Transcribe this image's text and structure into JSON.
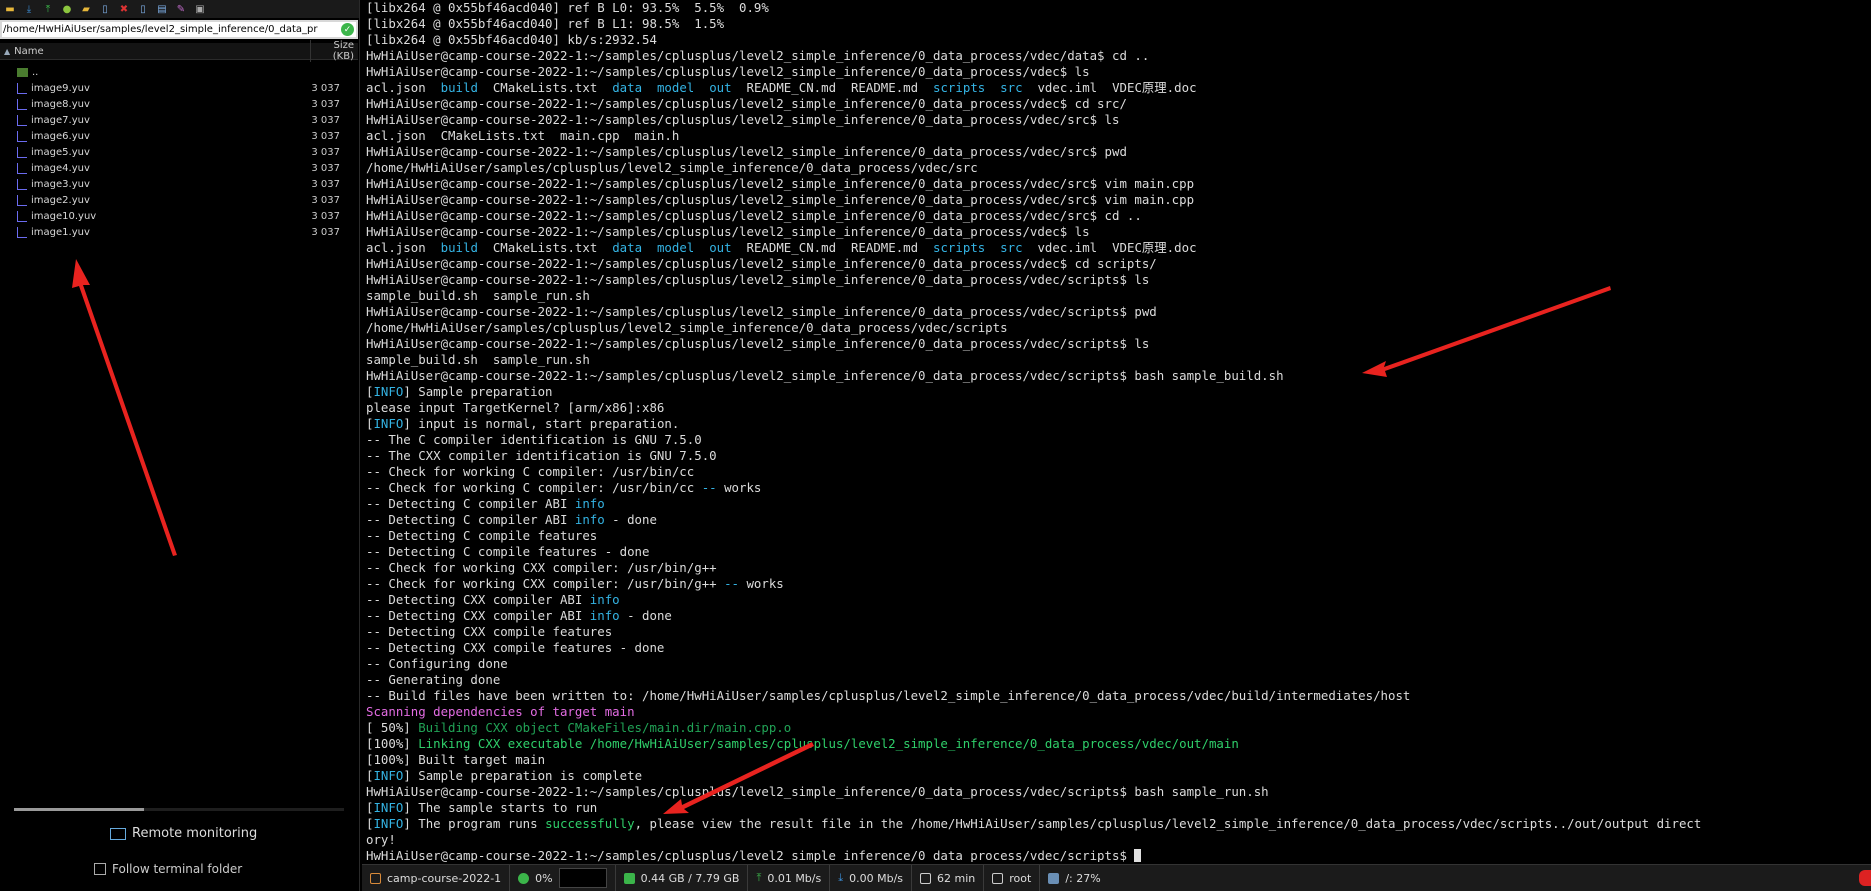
{
  "file_panel": {
    "path": "/home/HwHiAiUser/samples/level2_simple_inference/0_data_pr",
    "columns": {
      "name": "Name",
      "size": "Size (KB)"
    },
    "files": [
      {
        "name": "..",
        "size": ""
      },
      {
        "name": "image9.yuv",
        "size": "3 037"
      },
      {
        "name": "image8.yuv",
        "size": "3 037"
      },
      {
        "name": "image7.yuv",
        "size": "3 037"
      },
      {
        "name": "image6.yuv",
        "size": "3 037"
      },
      {
        "name": "image5.yuv",
        "size": "3 037"
      },
      {
        "name": "image4.yuv",
        "size": "3 037"
      },
      {
        "name": "image3.yuv",
        "size": "3 037"
      },
      {
        "name": "image2.yuv",
        "size": "3 037"
      },
      {
        "name": "image10.yuv",
        "size": "3 037"
      },
      {
        "name": "image1.yuv",
        "size": "3 037"
      }
    ],
    "remote_monitoring_label": "Remote monitoring",
    "follow_terminal_label": "Follow terminal folder",
    "toolbar_icons": [
      "folder-icon",
      "download-icon",
      "upload-icon",
      "refresh-icon",
      "new-folder-icon",
      "new-file-icon",
      "delete-icon",
      "edit-icon",
      "properties-icon",
      "tools-icon",
      "terminal-icon"
    ]
  },
  "terminal": {
    "lines": [
      [
        {
          "t": "[libx264 @ 0x55bf46acd040] ref B L0: 93.5%  5.5%  0.9%"
        }
      ],
      [
        {
          "t": "[libx264 @ 0x55bf46acd040] ref B L1: 98.5%  1.5%"
        }
      ],
      [
        {
          "t": "[libx264 @ 0x55bf46acd040] kb/s:2932.54"
        }
      ],
      [
        {
          "t": "HwHiAiUser@camp-course-2022-1:~/samples/cplusplus/level2_simple_inference/0_data_process/vdec/data$ cd .."
        }
      ],
      [
        {
          "t": "HwHiAiUser@camp-course-2022-1:~/samples/cplusplus/level2_simple_inference/0_data_process/vdec$ ls"
        }
      ],
      [
        {
          "t": "acl.json  "
        },
        {
          "t": "build",
          "c": "cyan"
        },
        {
          "t": "  CMakeLists.txt  "
        },
        {
          "t": "data",
          "c": "cyan"
        },
        {
          "t": "  "
        },
        {
          "t": "model",
          "c": "cyan"
        },
        {
          "t": "  "
        },
        {
          "t": "out",
          "c": "cyan"
        },
        {
          "t": "  README_CN.md  README.md  "
        },
        {
          "t": "scripts",
          "c": "cyan"
        },
        {
          "t": "  "
        },
        {
          "t": "src",
          "c": "cyan"
        },
        {
          "t": "  vdec.iml  VDEC原理.doc"
        }
      ],
      [
        {
          "t": "HwHiAiUser@camp-course-2022-1:~/samples/cplusplus/level2_simple_inference/0_data_process/vdec$ cd src/"
        }
      ],
      [
        {
          "t": "HwHiAiUser@camp-course-2022-1:~/samples/cplusplus/level2_simple_inference/0_data_process/vdec/src$ ls"
        }
      ],
      [
        {
          "t": "acl.json  CMakeLists.txt  main.cpp  main.h"
        }
      ],
      [
        {
          "t": "HwHiAiUser@camp-course-2022-1:~/samples/cplusplus/level2_simple_inference/0_data_process/vdec/src$ pwd"
        }
      ],
      [
        {
          "t": "/home/HwHiAiUser/samples/cplusplus/level2_simple_inference/0_data_process/vdec/src"
        }
      ],
      [
        {
          "t": "HwHiAiUser@camp-course-2022-1:~/samples/cplusplus/level2_simple_inference/0_data_process/vdec/src$ vim main.cpp"
        }
      ],
      [
        {
          "t": "HwHiAiUser@camp-course-2022-1:~/samples/cplusplus/level2_simple_inference/0_data_process/vdec/src$ vim main.cpp"
        }
      ],
      [
        {
          "t": "HwHiAiUser@camp-course-2022-1:~/samples/cplusplus/level2_simple_inference/0_data_process/vdec/src$ cd .."
        }
      ],
      [
        {
          "t": "HwHiAiUser@camp-course-2022-1:~/samples/cplusplus/level2_simple_inference/0_data_process/vdec$ ls"
        }
      ],
      [
        {
          "t": "acl.json  "
        },
        {
          "t": "build",
          "c": "cyan"
        },
        {
          "t": "  CMakeLists.txt  "
        },
        {
          "t": "data",
          "c": "cyan"
        },
        {
          "t": "  "
        },
        {
          "t": "model",
          "c": "cyan"
        },
        {
          "t": "  "
        },
        {
          "t": "out",
          "c": "cyan"
        },
        {
          "t": "  README_CN.md  README.md  "
        },
        {
          "t": "scripts",
          "c": "cyan"
        },
        {
          "t": "  "
        },
        {
          "t": "src",
          "c": "cyan"
        },
        {
          "t": "  vdec.iml  VDEC原理.doc"
        }
      ],
      [
        {
          "t": "HwHiAiUser@camp-course-2022-1:~/samples/cplusplus/level2_simple_inference/0_data_process/vdec$ cd scripts/"
        }
      ],
      [
        {
          "t": "HwHiAiUser@camp-course-2022-1:~/samples/cplusplus/level2_simple_inference/0_data_process/vdec/scripts$ ls"
        }
      ],
      [
        {
          "t": "sample_build.sh  sample_run.sh"
        }
      ],
      [
        {
          "t": "HwHiAiUser@camp-course-2022-1:~/samples/cplusplus/level2_simple_inference/0_data_process/vdec/scripts$ pwd"
        }
      ],
      [
        {
          "t": "/home/HwHiAiUser/samples/cplusplus/level2_simple_inference/0_data_process/vdec/scripts"
        }
      ],
      [
        {
          "t": "HwHiAiUser@camp-course-2022-1:~/samples/cplusplus/level2_simple_inference/0_data_process/vdec/scripts$ ls"
        }
      ],
      [
        {
          "t": "sample_build.sh  sample_run.sh"
        }
      ],
      [
        {
          "t": "HwHiAiUser@camp-course-2022-1:~/samples/cplusplus/level2_simple_inference/0_data_process/vdec/scripts$ bash sample_build.sh"
        }
      ],
      [
        {
          "t": "["
        },
        {
          "t": "INFO",
          "c": "cyan"
        },
        {
          "t": "] Sample preparation"
        }
      ],
      [
        {
          "t": "please input TargetKernel? [arm/x86]:x86"
        }
      ],
      [
        {
          "t": "["
        },
        {
          "t": "INFO",
          "c": "cyan"
        },
        {
          "t": "] input is normal, start preparation."
        }
      ],
      [
        {
          "t": "-- The C compiler identification is GNU 7.5.0"
        }
      ],
      [
        {
          "t": "-- The CXX compiler identification is GNU 7.5.0"
        }
      ],
      [
        {
          "t": "-- Check for working C compiler: /usr/bin/cc"
        }
      ],
      [
        {
          "t": "-- Check for working C compiler: /usr/bin/cc "
        },
        {
          "t": "--",
          "c": "cyan"
        },
        {
          "t": " works"
        }
      ],
      [
        {
          "t": "-- Detecting C compiler ABI "
        },
        {
          "t": "info",
          "c": "cyan"
        }
      ],
      [
        {
          "t": "-- Detecting C compiler ABI "
        },
        {
          "t": "info",
          "c": "cyan"
        },
        {
          "t": " - done"
        }
      ],
      [
        {
          "t": "-- Detecting C compile features"
        }
      ],
      [
        {
          "t": "-- Detecting C compile features - done"
        }
      ],
      [
        {
          "t": "-- Check for working CXX compiler: /usr/bin/g++"
        }
      ],
      [
        {
          "t": "-- Check for working CXX compiler: /usr/bin/g++ "
        },
        {
          "t": "--",
          "c": "cyan"
        },
        {
          "t": " works"
        }
      ],
      [
        {
          "t": "-- Detecting CXX compiler ABI "
        },
        {
          "t": "info",
          "c": "cyan"
        }
      ],
      [
        {
          "t": "-- Detecting CXX compiler ABI "
        },
        {
          "t": "info",
          "c": "cyan"
        },
        {
          "t": " - done"
        }
      ],
      [
        {
          "t": "-- Detecting CXX compile features"
        }
      ],
      [
        {
          "t": "-- Detecting CXX compile features - done"
        }
      ],
      [
        {
          "t": "-- Configuring done"
        }
      ],
      [
        {
          "t": "-- Generating done"
        }
      ],
      [
        {
          "t": "-- Build files have been written to: /home/HwHiAiUser/samples/cplusplus/level2_simple_inference/0_data_process/vdec/build/intermediates/host"
        }
      ],
      [
        {
          "t": "Scanning dependencies of target main",
          "c": "magenta"
        }
      ],
      [
        {
          "t": "[ 50%] "
        },
        {
          "t": "Building CXX object CMakeFiles/main.dir/main.cpp.o",
          "c": "green-dim"
        }
      ],
      [
        {
          "t": "[100%] "
        },
        {
          "t": "Linking CXX executable /home/HwHiAiUser/samples/cplusplus/level2_simple_inference/0_data_process/vdec/out/main",
          "c": "green"
        }
      ],
      [
        {
          "t": "[100%] Built target main"
        }
      ],
      [
        {
          "t": "["
        },
        {
          "t": "INFO",
          "c": "cyan"
        },
        {
          "t": "] Sample preparation is complete"
        }
      ],
      [
        {
          "t": "HwHiAiUser@camp-course-2022-1:~/samples/cplusplus/level2_simple_inference/0_data_process/vdec/scripts$ bash sample_run.sh"
        }
      ],
      [
        {
          "t": "["
        },
        {
          "t": "INFO",
          "c": "cyan"
        },
        {
          "t": "] The sample starts to run"
        }
      ],
      [
        {
          "t": "["
        },
        {
          "t": "INFO",
          "c": "cyan"
        },
        {
          "t": "] The program runs "
        },
        {
          "t": "successfully",
          "c": "green"
        },
        {
          "t": ", please view the result file in the /home/HwHiAiUser/samples/cplusplus/level2_simple_inference/0_data_process/vdec/scripts../out/output direct"
        }
      ],
      [
        {
          "t": "ory!"
        }
      ],
      [
        {
          "t": "HwHiAiUser@camp-course-2022-1:~/samples/cplusplus/level2_simple_inference/0_data_process/vdec/scripts$ "
        }
      ]
    ]
  },
  "statusbar": {
    "host": "camp-course-2022-1",
    "cpu": "0%",
    "memory": "0.44 GB / 7.79 GB",
    "upload": "0.01 Mb/s",
    "download": "0.00 Mb/s",
    "uptime": "62 min",
    "user": "root",
    "disk": "/: 27%"
  },
  "colors": {
    "terminal_bg": "#000000",
    "cyan": "#34b3e3",
    "magenta": "#e36ce3",
    "green": "#2fcf6a",
    "annotation_arrow": "#e8231f"
  }
}
